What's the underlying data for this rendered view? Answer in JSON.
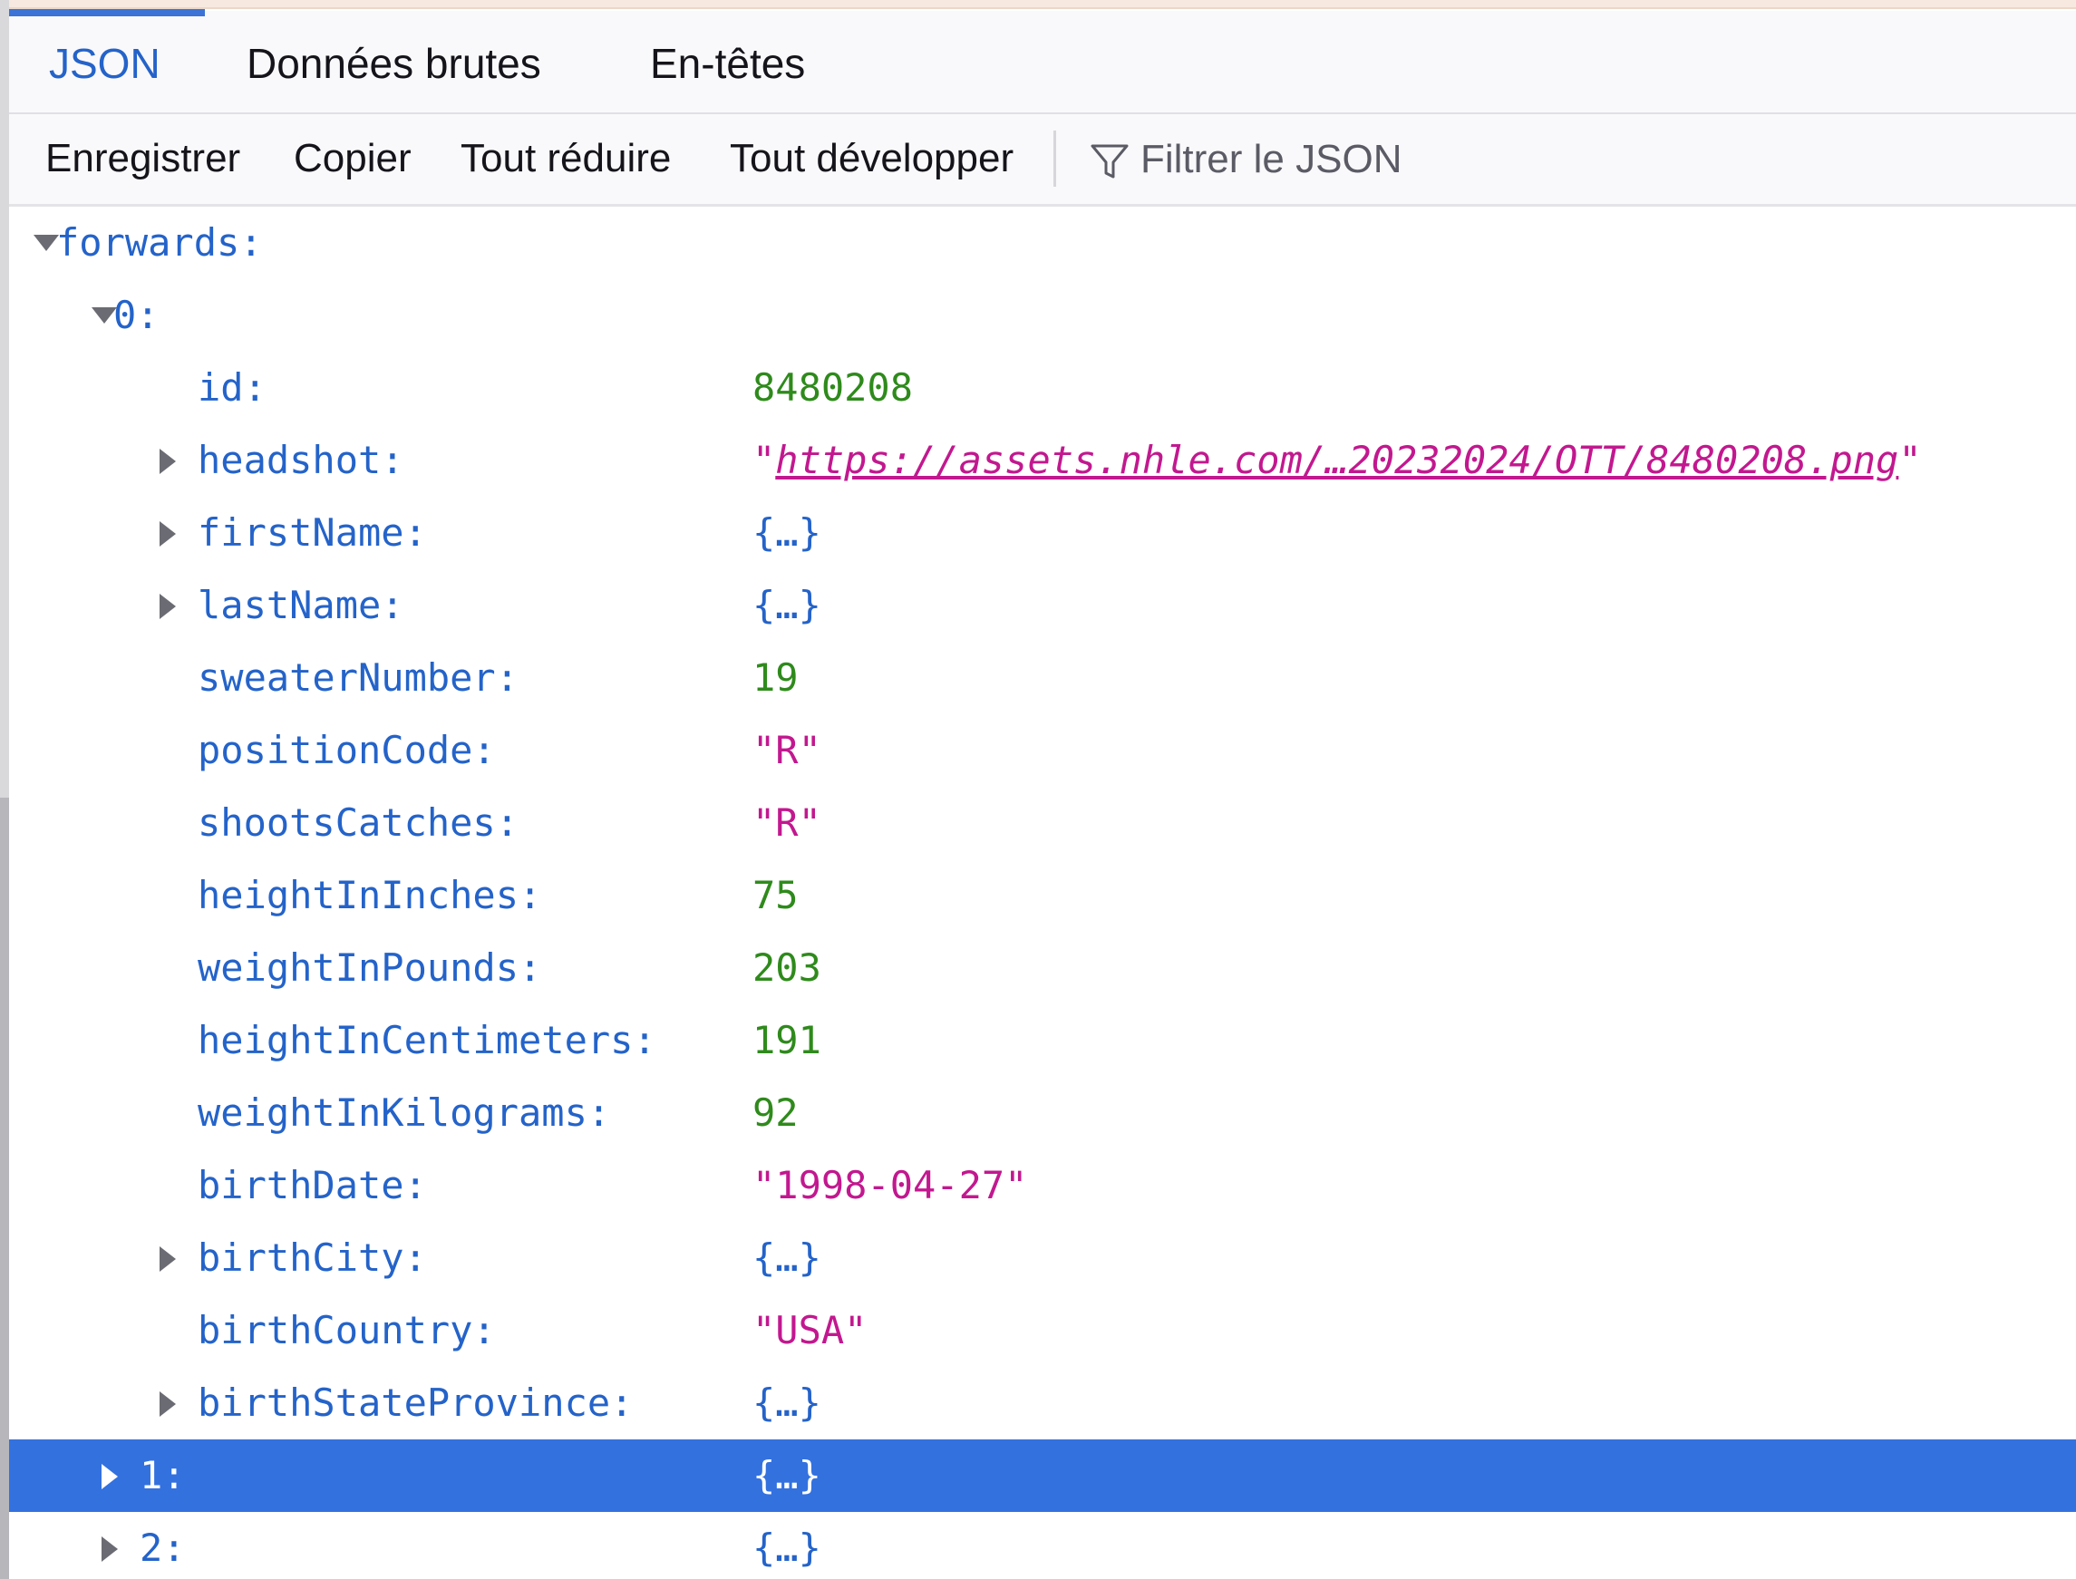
{
  "colors": {
    "accent": "#2463c9",
    "number": "#2f8a1c",
    "string": "#c2188f",
    "selected_row": "#3371df"
  },
  "tabs": [
    {
      "label": "JSON",
      "active": true
    },
    {
      "label": "Données brutes",
      "active": false
    },
    {
      "label": "En-têtes",
      "active": false
    }
  ],
  "toolbar": {
    "save_label": "Enregistrer",
    "copy_label": "Copier",
    "collapse_all_label": "Tout réduire",
    "expand_all_label": "Tout développer",
    "filter_placeholder": "Filtrer le JSON",
    "filter_icon": "filter-icon"
  },
  "tree": {
    "root_key": "forwards:",
    "item0_key": "0:",
    "rows": [
      {
        "key": "id:",
        "value": "8480208"
      },
      {
        "key": "headshot:",
        "quote_open": "\"",
        "value": "https://assets.nhle.com/…20232024/OTT/8480208.png",
        "quote_close": "\""
      },
      {
        "key": "firstName:",
        "value": "{…}"
      },
      {
        "key": "lastName:",
        "value": "{…}"
      },
      {
        "key": "sweaterNumber:",
        "value": "19"
      },
      {
        "key": "positionCode:",
        "value": "\"R\""
      },
      {
        "key": "shootsCatches:",
        "value": "\"R\""
      },
      {
        "key": "heightInInches:",
        "value": "75"
      },
      {
        "key": "weightInPounds:",
        "value": "203"
      },
      {
        "key": "heightInCentimeters:",
        "value": "191"
      },
      {
        "key": "weightInKilograms:",
        "value": "92"
      },
      {
        "key": "birthDate:",
        "value": "\"1998-04-27\""
      },
      {
        "key": "birthCity:",
        "value": "{…}"
      },
      {
        "key": "birthCountry:",
        "value": "\"USA\""
      },
      {
        "key": "birthStateProvince:",
        "value": "{…}"
      }
    ],
    "item1": {
      "key": "1:",
      "value": "{…}"
    },
    "item2": {
      "key": "2:",
      "value": "{…}"
    }
  }
}
